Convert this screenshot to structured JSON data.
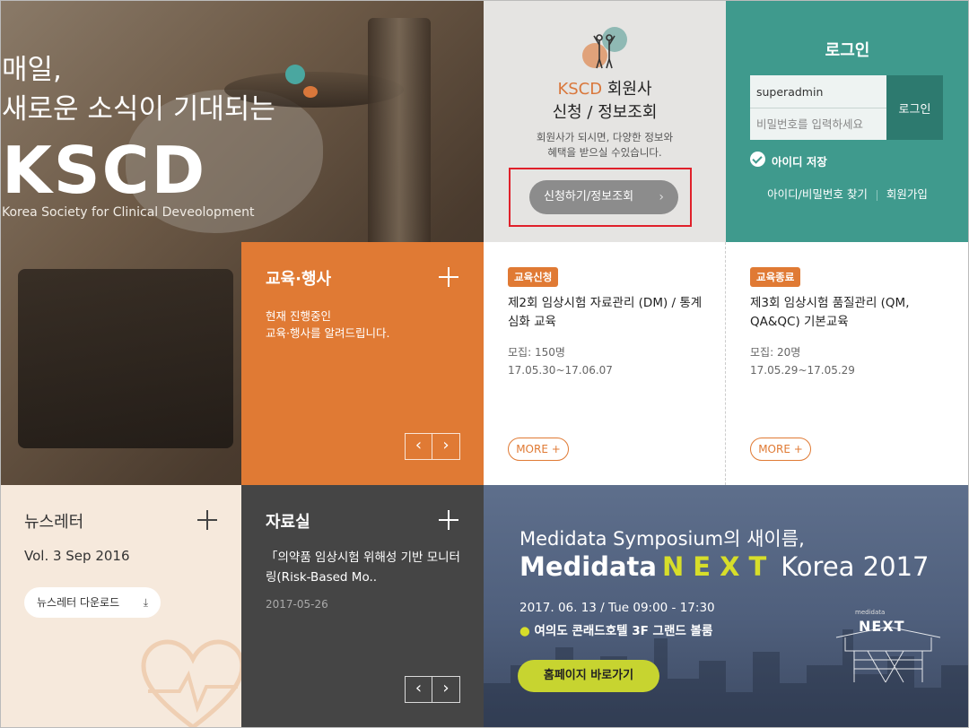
{
  "hero": {
    "line1": "매일,",
    "line2": "새로운 소식이 기대되는",
    "brand": "KSCD",
    "subtitle": "Korea Society for Clinical Deveolopment"
  },
  "member": {
    "title_accent": "KSCD",
    "title_rest": " 회원사",
    "title_line2": "신청 / 정보조회",
    "desc_line1": "회원사가 되시면, 다양한 정보와",
    "desc_line2": "혜택을 받으실 수있습니다.",
    "button": "신청하기/정보조회"
  },
  "login": {
    "title": "로그인",
    "id_value": "superadmin",
    "pw_placeholder": "비밀번호를 입력하세요",
    "button": "로그인",
    "save_id": "아이디 저장",
    "find_link": "아이디/비밀번호 찾기",
    "join_link": "회원가입"
  },
  "edu": {
    "title": "교육·행사",
    "desc_line1": "현재 진행중인",
    "desc_line2": "교육·행사를 알려드립니다."
  },
  "courses": [
    {
      "badge": "교육신청",
      "title": "제2회 임상시험 자료관리 (DM) / 통계 심화 교육",
      "recruit": "모집: 150명",
      "period": "17.05.30~17.06.07",
      "more": "MORE +"
    },
    {
      "badge": "교육종료",
      "title": "제3회 임상시험 품질관리 (QM, QA&QC) 기본교육",
      "recruit": "모집: 20명",
      "period": "17.05.29~17.05.29",
      "more": "MORE +"
    }
  ],
  "newsletter": {
    "title": "뉴스레터",
    "volume": "Vol. 3 Sep 2016",
    "button": "뉴스레터 다운로드"
  },
  "archive": {
    "title": "자료실",
    "item_title": "「의약품 임상시험 위해성 기반 모니터링(Risk-Based Mo..",
    "item_date": "2017-05-26"
  },
  "banner": {
    "line1": "Medidata Symposium의 새이름,",
    "brand": "Medidata",
    "next": "NEXT",
    "rest": "Korea 2017",
    "date": "2017. 06. 13 / Tue 09:00 - 17:30",
    "place": "여의도 콘래드호텔 3F 그랜드 볼룸",
    "button": "홈페이지 바로가기",
    "logo_small": "medidata",
    "logo_next": "NEXT"
  },
  "colors": {
    "orange": "#e07a34",
    "teal": "#3f9a8d",
    "lime": "#c7d430",
    "highlight_red": "#e0202a"
  },
  "icons": {
    "chevron_right": "›",
    "prev": "‹",
    "next": "›",
    "download": "⤓",
    "pin": "●"
  }
}
